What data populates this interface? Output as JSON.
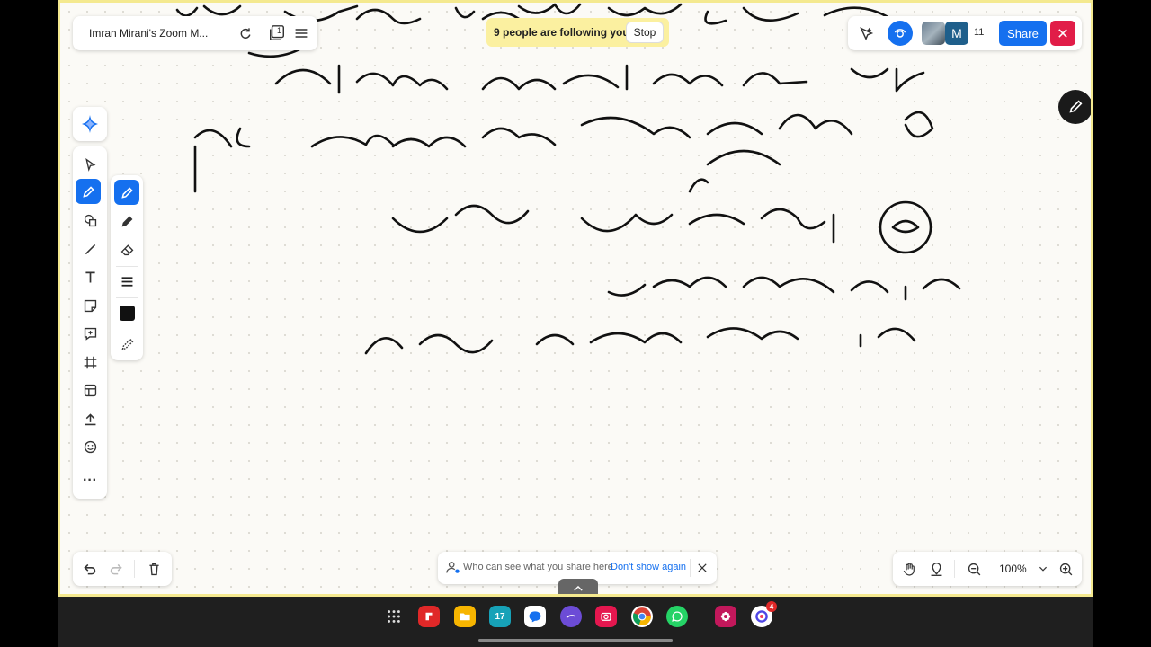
{
  "header": {
    "board_title": "Imran Mirani's Zoom M...",
    "page_count": "1",
    "follow_text": "9 people are following you",
    "stop_label": "Stop",
    "avatar_letter": "M",
    "participant_count": "11",
    "share_label": "Share"
  },
  "notice": {
    "text": "Who can see what you share here",
    "dismiss_label": "Don't show again"
  },
  "zoom": {
    "level": "100%"
  },
  "toolbar": {
    "tools": [
      "select-icon",
      "pen-icon",
      "shapes-icon",
      "line-icon",
      "text-icon",
      "sticky-note-icon",
      "comment-icon",
      "frame-icon",
      "template-icon",
      "upload-icon",
      "emoji-icon",
      "more-icon"
    ],
    "more_label": "···"
  },
  "taskbar": {
    "calendar_day": "17",
    "badge": "4"
  },
  "colors": {
    "accent": "#1570ef",
    "follow_bg": "#fbf0a0",
    "close_red": "#e11d48",
    "board_border": "#f4e98f"
  }
}
